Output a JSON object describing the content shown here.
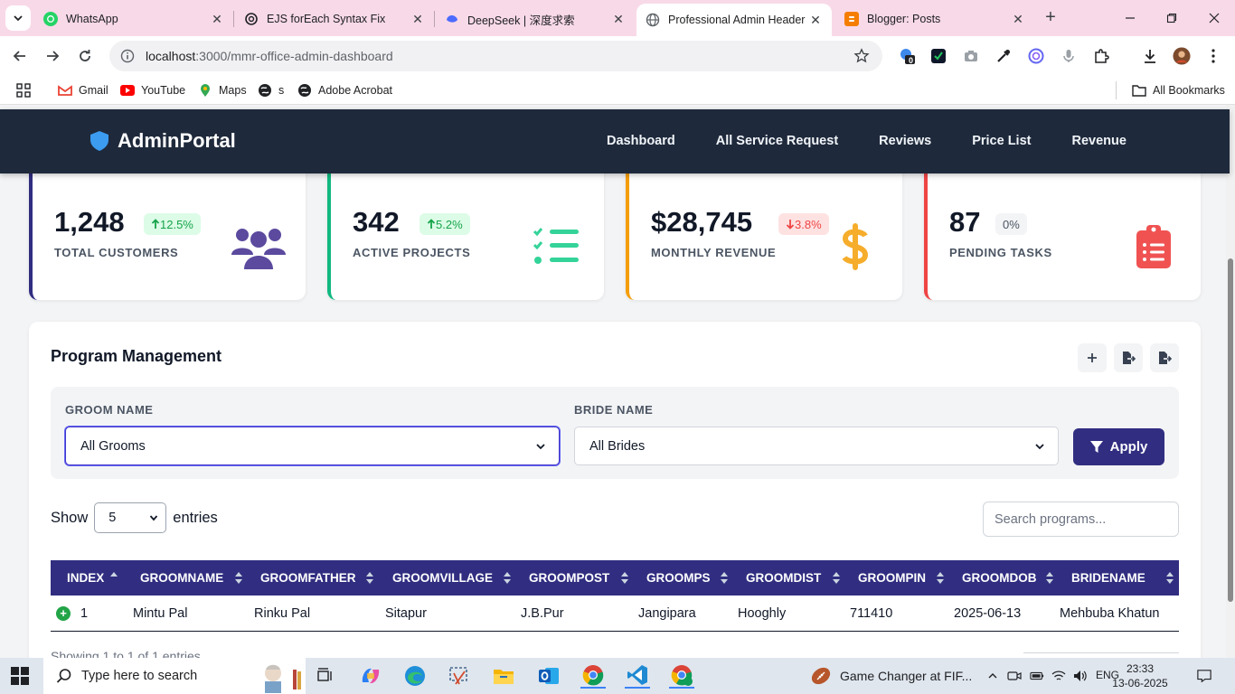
{
  "browser": {
    "tabs": [
      {
        "title": "WhatsApp"
      },
      {
        "title": "EJS forEach Syntax Fix"
      },
      {
        "title": "DeepSeek | 深度求索"
      },
      {
        "title": "Professional Admin Header"
      },
      {
        "title": "Blogger: Posts"
      }
    ],
    "url_host": "localhost",
    "url_path": ":3000/mmr-office-admin-dashboard",
    "extension_badge": "0",
    "bookmarks": [
      "Gmail",
      "YouTube",
      "Maps",
      "s",
      "Adobe Acrobat"
    ],
    "all_bookmarks": "All Bookmarks"
  },
  "app": {
    "brand": "AdminPortal",
    "nav": [
      "Dashboard",
      "All Service Request",
      "Reviews",
      "Price List",
      "Revenue"
    ],
    "accent": "#312e81",
    "header_bg": "#1e293b"
  },
  "stats": [
    {
      "value": "1,248",
      "change": "12.5%",
      "direction": "up",
      "label": "TOTAL CUSTOMERS",
      "color": "#312e81",
      "icon": "users-icon"
    },
    {
      "value": "342",
      "change": "5.2%",
      "direction": "up",
      "label": "ACTIVE PROJECTS",
      "color": "#10b981",
      "icon": "list-check-icon"
    },
    {
      "value": "$28,745",
      "change": "3.8%",
      "direction": "down",
      "label": "MONTHLY REVENUE",
      "color": "#f59e0b",
      "icon": "dollar-icon"
    },
    {
      "value": "87",
      "change": "0%",
      "direction": "none",
      "label": "PENDING TASKS",
      "color": "#ef4444",
      "icon": "clipboard-list-icon"
    }
  ],
  "panel": {
    "title": "Program Management",
    "filters": {
      "groom_label": "GROOM NAME",
      "groom_value": "All Grooms",
      "bride_label": "BRIDE NAME",
      "bride_value": "All Brides",
      "apply": "Apply"
    },
    "show_prefix": "Show",
    "show_value": "5",
    "show_suffix": "entries",
    "search_placeholder": "Search programs...",
    "columns": [
      "INDEX",
      "GROOMNAME",
      "GROOMFATHER",
      "GROOMVILLAGE",
      "GROOMPOST",
      "GROOMPS",
      "GROOMDIST",
      "GROOMPIN",
      "GROOMDOB",
      "BRIDENAME"
    ],
    "rows": [
      [
        "1",
        "Mintu Pal",
        "Rinku Pal",
        "Sitapur",
        "J.B.Pur",
        "Jangipara",
        "Hooghly",
        "711410",
        "2025-06-13",
        "Mehbuba Khatun"
      ]
    ],
    "info": "Showing 1 to 1 of 1 entries"
  },
  "taskbar": {
    "search_placeholder": "Type here to search",
    "news": "Game Changer at FIF...",
    "lang": "ENG",
    "time": "23:33",
    "date": "13-06-2025"
  }
}
